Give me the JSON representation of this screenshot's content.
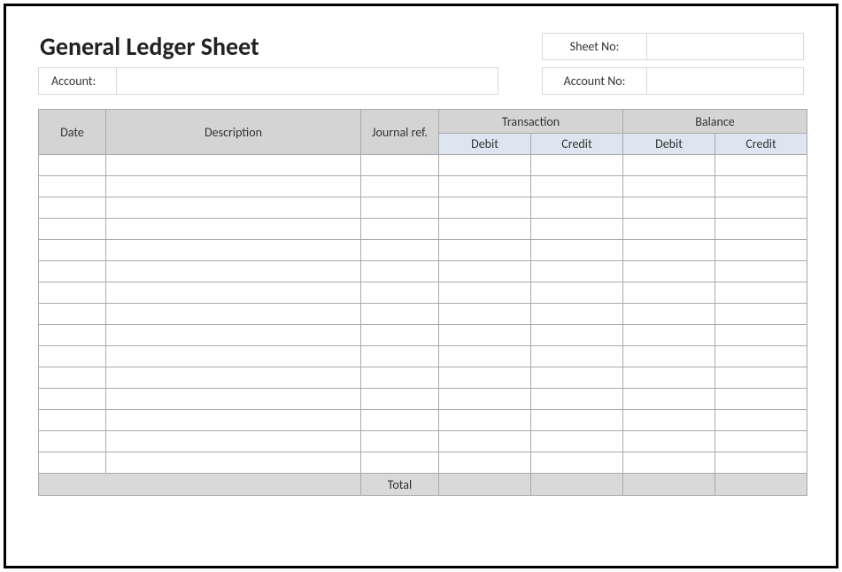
{
  "title": "General Ledger Sheet",
  "sheetNo": {
    "label": "Sheet No:",
    "value": ""
  },
  "account": {
    "label": "Account:",
    "value": ""
  },
  "accountNo": {
    "label": "Account No:",
    "value": ""
  },
  "columns": {
    "date": "Date",
    "description": "Description",
    "journalRef": "Journal ref.",
    "transaction": "Transaction",
    "balance": "Balance",
    "debit": "Debit",
    "credit": "Credit"
  },
  "rows": [
    {
      "date": "",
      "description": "",
      "ref": "",
      "txDebit": "",
      "txCredit": "",
      "balDebit": "",
      "balCredit": ""
    },
    {
      "date": "",
      "description": "",
      "ref": "",
      "txDebit": "",
      "txCredit": "",
      "balDebit": "",
      "balCredit": ""
    },
    {
      "date": "",
      "description": "",
      "ref": "",
      "txDebit": "",
      "txCredit": "",
      "balDebit": "",
      "balCredit": ""
    },
    {
      "date": "",
      "description": "",
      "ref": "",
      "txDebit": "",
      "txCredit": "",
      "balDebit": "",
      "balCredit": ""
    },
    {
      "date": "",
      "description": "",
      "ref": "",
      "txDebit": "",
      "txCredit": "",
      "balDebit": "",
      "balCredit": ""
    },
    {
      "date": "",
      "description": "",
      "ref": "",
      "txDebit": "",
      "txCredit": "",
      "balDebit": "",
      "balCredit": ""
    },
    {
      "date": "",
      "description": "",
      "ref": "",
      "txDebit": "",
      "txCredit": "",
      "balDebit": "",
      "balCredit": ""
    },
    {
      "date": "",
      "description": "",
      "ref": "",
      "txDebit": "",
      "txCredit": "",
      "balDebit": "",
      "balCredit": ""
    },
    {
      "date": "",
      "description": "",
      "ref": "",
      "txDebit": "",
      "txCredit": "",
      "balDebit": "",
      "balCredit": ""
    },
    {
      "date": "",
      "description": "",
      "ref": "",
      "txDebit": "",
      "txCredit": "",
      "balDebit": "",
      "balCredit": ""
    },
    {
      "date": "",
      "description": "",
      "ref": "",
      "txDebit": "",
      "txCredit": "",
      "balDebit": "",
      "balCredit": ""
    },
    {
      "date": "",
      "description": "",
      "ref": "",
      "txDebit": "",
      "txCredit": "",
      "balDebit": "",
      "balCredit": ""
    },
    {
      "date": "",
      "description": "",
      "ref": "",
      "txDebit": "",
      "txCredit": "",
      "balDebit": "",
      "balCredit": ""
    },
    {
      "date": "",
      "description": "",
      "ref": "",
      "txDebit": "",
      "txCredit": "",
      "balDebit": "",
      "balCredit": ""
    },
    {
      "date": "",
      "description": "",
      "ref": "",
      "txDebit": "",
      "txCredit": "",
      "balDebit": "",
      "balCredit": ""
    }
  ],
  "footer": {
    "totalLabel": "Total",
    "txDebit": "",
    "txCredit": "",
    "balDebit": "",
    "balCredit": ""
  }
}
